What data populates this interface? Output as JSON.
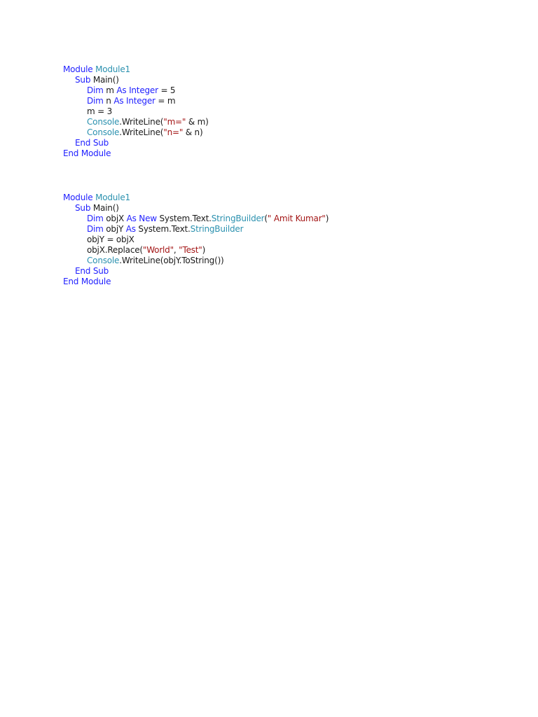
{
  "code_blocks": [
    {
      "lines": [
        {
          "indent": 0,
          "tokens": [
            {
              "t": "Module ",
              "c": "kw"
            },
            {
              "t": "Module1",
              "c": "type"
            }
          ]
        },
        {
          "indent": 1,
          "tokens": [
            {
              "t": "Sub ",
              "c": "kw"
            },
            {
              "t": "Main()",
              "c": "plain"
            }
          ]
        },
        {
          "indent": 2,
          "tokens": [
            {
              "t": "Dim ",
              "c": "kw"
            },
            {
              "t": "m ",
              "c": "plain"
            },
            {
              "t": "As Integer",
              "c": "kw"
            },
            {
              "t": " = 5",
              "c": "plain"
            }
          ]
        },
        {
          "indent": 2,
          "tokens": [
            {
              "t": "Dim ",
              "c": "kw"
            },
            {
              "t": "n ",
              "c": "plain"
            },
            {
              "t": "As Integer",
              "c": "kw"
            },
            {
              "t": " = m",
              "c": "plain"
            }
          ]
        },
        {
          "indent": 2,
          "tokens": [
            {
              "t": "m = 3",
              "c": "plain"
            }
          ]
        },
        {
          "indent": 2,
          "tokens": [
            {
              "t": "Console",
              "c": "type"
            },
            {
              "t": ".WriteLine(",
              "c": "plain"
            },
            {
              "t": "\"m=\"",
              "c": "str"
            },
            {
              "t": " & m)",
              "c": "plain"
            }
          ]
        },
        {
          "indent": 2,
          "tokens": [
            {
              "t": "Console",
              "c": "type"
            },
            {
              "t": ".WriteLine(",
              "c": "plain"
            },
            {
              "t": "\"n=\"",
              "c": "str"
            },
            {
              "t": " & n)",
              "c": "plain"
            }
          ]
        },
        {
          "indent": 1,
          "tokens": [
            {
              "t": "End Sub",
              "c": "kw"
            }
          ]
        },
        {
          "indent": 0,
          "tokens": [
            {
              "t": "End Module",
              "c": "kw"
            }
          ]
        }
      ]
    },
    {
      "lines": [
        {
          "indent": 0,
          "tokens": [
            {
              "t": "Module ",
              "c": "kw"
            },
            {
              "t": "Module1",
              "c": "type"
            }
          ]
        },
        {
          "indent": 1,
          "tokens": [
            {
              "t": "Sub ",
              "c": "kw"
            },
            {
              "t": "Main()",
              "c": "plain"
            }
          ]
        },
        {
          "indent": 2,
          "tokens": [
            {
              "t": "Dim ",
              "c": "kw"
            },
            {
              "t": "objX ",
              "c": "plain"
            },
            {
              "t": "As New ",
              "c": "kw"
            },
            {
              "t": "System.Text.",
              "c": "plain"
            },
            {
              "t": "StringBuilder",
              "c": "type"
            },
            {
              "t": "(",
              "c": "plain"
            },
            {
              "t": "\" Amit Kumar\"",
              "c": "str"
            },
            {
              "t": ")",
              "c": "plain"
            }
          ]
        },
        {
          "indent": 2,
          "tokens": [
            {
              "t": "Dim ",
              "c": "kw"
            },
            {
              "t": "objY ",
              "c": "plain"
            },
            {
              "t": "As ",
              "c": "kw"
            },
            {
              "t": "System.Text.",
              "c": "plain"
            },
            {
              "t": "StringBuilder",
              "c": "type"
            }
          ]
        },
        {
          "indent": 2,
          "tokens": [
            {
              "t": "objY = objX",
              "c": "plain"
            }
          ]
        },
        {
          "indent": 2,
          "tokens": [
            {
              "t": "objX.Replace(",
              "c": "plain"
            },
            {
              "t": "\"World\"",
              "c": "str"
            },
            {
              "t": ", ",
              "c": "plain"
            },
            {
              "t": "\"Test\"",
              "c": "str"
            },
            {
              "t": ")",
              "c": "plain"
            }
          ]
        },
        {
          "indent": 2,
          "tokens": [
            {
              "t": "Console",
              "c": "type"
            },
            {
              "t": ".WriteLine(objY.ToString())",
              "c": "plain"
            }
          ]
        },
        {
          "indent": 1,
          "tokens": [
            {
              "t": "End Sub",
              "c": "kw"
            }
          ]
        },
        {
          "indent": 0,
          "tokens": [
            {
              "t": "End Module",
              "c": "kw"
            }
          ]
        }
      ]
    }
  ],
  "colors": {
    "keyword": "#1f1fff",
    "type": "#2b91af",
    "string": "#a31515",
    "plain": "#1a1a1a"
  }
}
